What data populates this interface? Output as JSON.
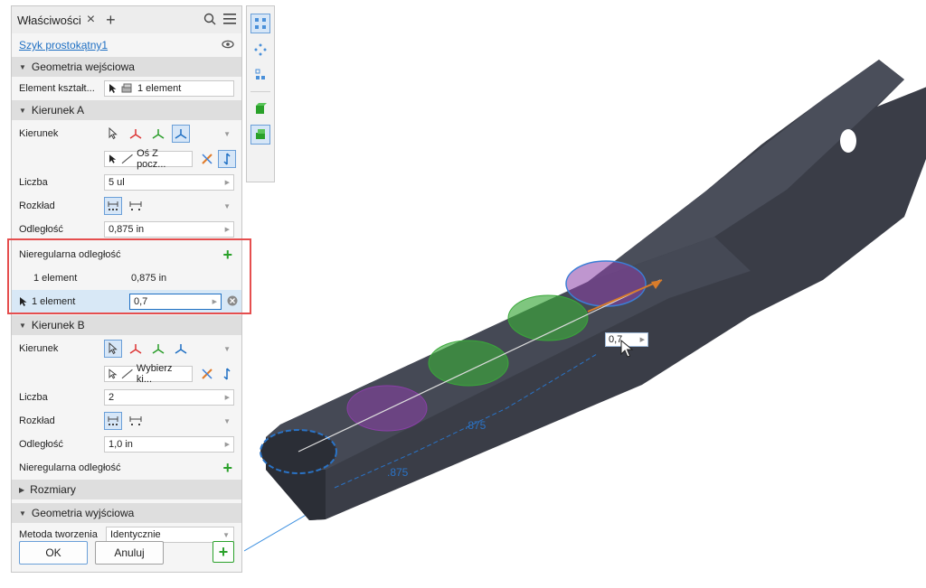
{
  "panel": {
    "tab_title": "Właściwości",
    "feature_name": "Szyk prostokątny1",
    "sections": {
      "input_geometry": "Geometria wejściowa",
      "direction_a": "Kierunek A",
      "direction_b": "Kierunek B",
      "sizes": "Rozmiary",
      "output_geometry": "Geometria wyjściowa"
    },
    "feature_row": {
      "label": "Element kształt...",
      "value": "1 element"
    },
    "dir_a": {
      "direction_label": "Kierunek",
      "axis_value": "Oś Z pocz...",
      "count_label": "Liczba",
      "count_value": "5 ul",
      "distribution_label": "Rozkład",
      "distance_label": "Odległość",
      "distance_value": "0,875 in",
      "irregular_label": "Nieregularna odległość",
      "irregular_rows": [
        {
          "label": "1 element",
          "value": "0,875 in"
        },
        {
          "label": "1 element",
          "value": "0,7"
        }
      ]
    },
    "dir_b": {
      "direction_label": "Kierunek",
      "axis_value": "Wybierz ki...",
      "count_label": "Liczba",
      "count_value": "2",
      "distribution_label": "Rozkład",
      "distance_label": "Odległość",
      "distance_value": "1,0 in",
      "irregular_label": "Nieregularna odległość"
    },
    "output": {
      "method_label": "Metoda tworzenia",
      "method_value": "Identycznie"
    },
    "buttons": {
      "ok": "OK",
      "cancel": "Anuluj"
    }
  },
  "viewport": {
    "input_value": "0,7",
    "dimension_labels": [
      ".875",
      ".875"
    ]
  },
  "colors": {
    "accent": "#1e6fc3",
    "highlight_border": "#e54e4e",
    "add_green": "#2aa12a",
    "part_dark": "#3a3d47",
    "hole_purple": "#8b3fa8",
    "hole_green": "#3aa83a",
    "dimension_blue": "#2a73c6"
  }
}
